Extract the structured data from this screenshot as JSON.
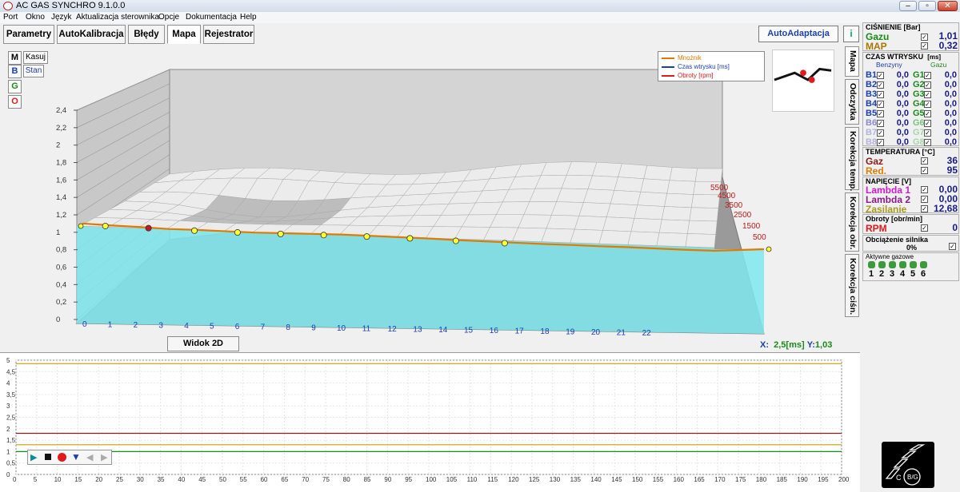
{
  "window": {
    "title": "AC GAS SYNCHRO  9.1.0.0"
  },
  "menu": [
    "Port",
    "Okno",
    "Język",
    "Aktualizacja sterownika",
    "Opcje",
    "Dokumentacja",
    "Help"
  ],
  "tabs": [
    "Parametry",
    "AutoKalibracja",
    "Błędy",
    "Mapa",
    "Rejestrator"
  ],
  "active_tab": "Mapa",
  "toolbar": {
    "autoadaptacja": "AutoAdaptacja",
    "info": "i"
  },
  "map_buttons": {
    "m": "M",
    "b": "B",
    "g": "G",
    "o": "O",
    "kasuj": "Kasuj",
    "stan": "Stan"
  },
  "legend": [
    {
      "label": "Mnożnik",
      "color": "#e07b00"
    },
    {
      "label": "Czas wtrysku [ms]",
      "color": "#1a3fb0"
    },
    {
      "label": "Obroty [rpm]",
      "color": "#e01a1a"
    }
  ],
  "rpm_labels": [
    "5500",
    "4500",
    "3500",
    "2500",
    "1500",
    "500"
  ],
  "widok_button": "Widok 2D",
  "coords": {
    "x_label": "X:",
    "x_value": "2,5[ms]",
    "y_label": "Y:",
    "y_value": "1,03"
  },
  "vertical_tabs": [
    "Mapa",
    "Odczytka",
    "Korekcja temp.",
    "Korekcja obr.",
    "Korekcja ciśn."
  ],
  "chart_data": [
    {
      "type": "line",
      "title": "",
      "xlabel": "",
      "ylabel": "",
      "x_ticks": [
        "0",
        "1",
        "2",
        "3",
        "4",
        "5",
        "6",
        "7",
        "8",
        "9",
        "10",
        "11",
        "12",
        "13",
        "14",
        "15",
        "16",
        "17",
        "18",
        "19",
        "20",
        "21",
        "22"
      ],
      "y_ticks": [
        "0",
        "0,2",
        "0,4",
        "0,6",
        "0,8",
        "1",
        "1,2",
        "1,4",
        "1,6",
        "1,8",
        "2",
        "2,2",
        "2,4"
      ],
      "ylim": [
        0,
        2.5
      ],
      "series": [
        {
          "name": "Mnożnik",
          "x": [
            0,
            1,
            2,
            3,
            4,
            5,
            6,
            7,
            8,
            9,
            10,
            11,
            12,
            13,
            14,
            15,
            16,
            17,
            18,
            19,
            20,
            21,
            22
          ],
          "values": [
            1.08,
            1.05,
            1.03,
            1.0,
            1.0,
            0.99,
            0.98,
            0.99,
            1.0,
            1.01,
            1.0,
            0.99,
            0.98,
            0.96,
            0.95,
            0.94,
            0.93,
            0.93,
            0.92,
            0.92,
            0.91,
            0.9,
            0.9
          ]
        }
      ],
      "points_x": [
        0.8,
        2.3,
        3.9,
        5.4,
        6.9,
        8.4,
        9.9,
        11.4,
        13.0,
        14.7
      ],
      "selected_point_x": 2.3
    },
    {
      "type": "line",
      "title": "",
      "x_ticks": [
        "0",
        "5",
        "10",
        "15",
        "20",
        "25",
        "30",
        "35",
        "40",
        "45",
        "50",
        "55",
        "60",
        "65",
        "70",
        "75",
        "80",
        "85",
        "90",
        "95",
        "100",
        "105",
        "110",
        "115",
        "120",
        "125",
        "130",
        "135",
        "140",
        "145",
        "150",
        "155",
        "160",
        "165",
        "170",
        "175",
        "180",
        "185",
        "190",
        "195",
        "200"
      ],
      "y_ticks": [
        "0",
        "0,5",
        "1",
        "1,5",
        "2",
        "2,5",
        "3",
        "3,5",
        "4",
        "4,5",
        "5"
      ],
      "ylim": [
        0,
        5
      ],
      "xlim": [
        0,
        200
      ],
      "series": [
        {
          "color": "#c8a000",
          "values": [
            4.85
          ]
        },
        {
          "color": "#8b1a1a",
          "values": [
            1.8
          ]
        },
        {
          "color": "#c8a000",
          "values": [
            1.3
          ]
        },
        {
          "color": "#1a8a1a",
          "values": [
            1.0
          ]
        }
      ]
    }
  ],
  "player_buttons": [
    "play",
    "stop",
    "record",
    "down",
    "prev",
    "next"
  ],
  "side": {
    "cisnienie": {
      "title": "CIŚNIENIE [Bar]",
      "gazu_label": "Gazu",
      "gazu": "1,01",
      "map_label": "MAP",
      "map": "0,32"
    },
    "czas": {
      "title": "CZAS WTRYSKU",
      "unit": "[ms]",
      "benzyny": "Benzyny",
      "gazu": "Gazu",
      "rows": [
        {
          "b": "B1",
          "bv": "0,0",
          "g": "G1",
          "gv": "0,0"
        },
        {
          "b": "B2",
          "bv": "0,0",
          "g": "G2",
          "gv": "0,0"
        },
        {
          "b": "B3",
          "bv": "0,0",
          "g": "G3",
          "gv": "0,0"
        },
        {
          "b": "B4",
          "bv": "0,0",
          "g": "G4",
          "gv": "0,0"
        },
        {
          "b": "B5",
          "bv": "0,0",
          "g": "G5",
          "gv": "0,0"
        },
        {
          "b": "B6",
          "bv": "0,0",
          "g": "G6",
          "gv": "0,0"
        },
        {
          "b": "B7",
          "bv": "0,0",
          "g": "G7",
          "gv": "0,0"
        },
        {
          "b": "B8",
          "bv": "0,0",
          "g": "G8",
          "gv": "0,0"
        }
      ]
    },
    "temperatura": {
      "title": "TEMPERATURA  [°C]",
      "gaz_label": "Gaz",
      "gaz": "36",
      "red_label": "Red.",
      "red": "95"
    },
    "napiecie": {
      "title": "NAPIĘCIE [V]",
      "l1_label": "Lambda 1",
      "l1": "0,00",
      "l2_label": "Lambda 2",
      "l2": "0,00",
      "zas_label": "Zasilanie",
      "zas": "12,68"
    },
    "obroty": {
      "title": "Obroty [obr/min]",
      "rpm_label": "RPM",
      "rpm": "0"
    },
    "obciazenie": {
      "title": "Obciążenie silnika",
      "value": "0%"
    },
    "aktywne": {
      "title": "Aktywne gazowe",
      "nums": [
        "1",
        "2",
        "3",
        "4",
        "5",
        "6"
      ]
    }
  },
  "colors": {
    "accent": "#1a3fb0",
    "orange": "#e07b00",
    "red": "#e01a1a",
    "green": "#1a8a1a",
    "surface": "#7fe8ee"
  }
}
